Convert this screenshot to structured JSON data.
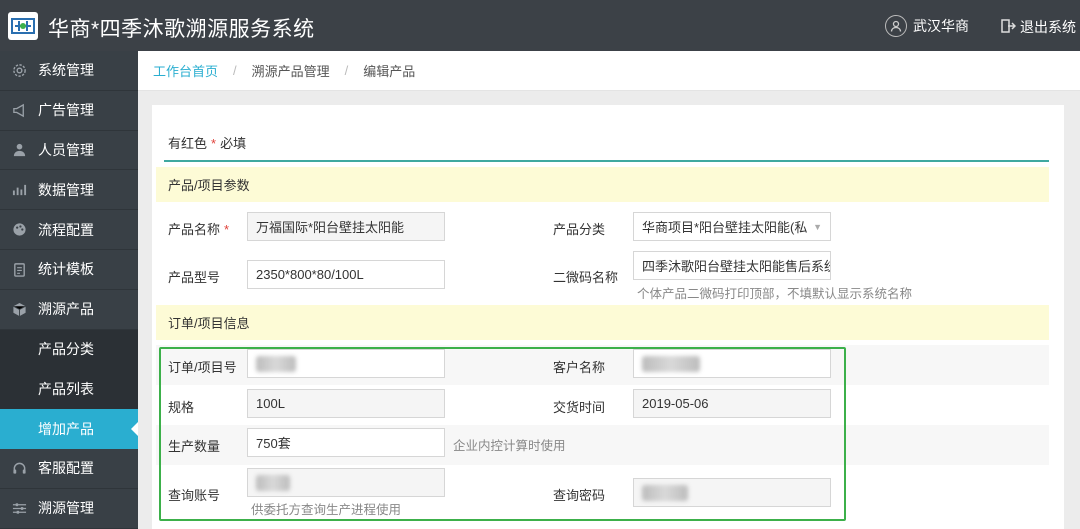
{
  "header": {
    "title": "华商*四季沐歌溯源服务系统",
    "user": "武汉华商",
    "logout": "退出系统"
  },
  "sidebar": {
    "items": [
      {
        "label": "系统管理",
        "icon": "gear-icon"
      },
      {
        "label": "广告管理",
        "icon": "megaphone-icon"
      },
      {
        "label": "人员管理",
        "icon": "person-icon"
      },
      {
        "label": "数据管理",
        "icon": "chart-icon"
      },
      {
        "label": "流程配置",
        "icon": "palette-icon"
      },
      {
        "label": "统计模板",
        "icon": "clipboard-icon"
      },
      {
        "label": "溯源产品",
        "icon": "box-icon"
      }
    ],
    "sub_items": [
      {
        "label": "产品分类"
      },
      {
        "label": "产品列表"
      },
      {
        "label": "增加产品",
        "active": true
      }
    ],
    "items_after": [
      {
        "label": "客服配置",
        "icon": "headset-icon"
      },
      {
        "label": "溯源管理",
        "icon": "sliders-icon"
      }
    ]
  },
  "breadcrumb": {
    "home": "工作台首页",
    "level1": "溯源产品管理",
    "current": "编辑产品"
  },
  "form": {
    "note_prefix": "有红色",
    "note_star": "*",
    "note_suffix": "必填",
    "section1": "产品/项目参数",
    "section2": "订单/项目信息",
    "product_name_label": "产品名称",
    "product_name_value": "万福国际*阳台壁挂太阳能",
    "product_category_label": "产品分类",
    "product_category_value": "华商项目*阳台壁挂太阳能(私",
    "product_model_label": "产品型号",
    "product_model_value": "2350*800*80/100L",
    "qrcode_name_label": "二微码名称",
    "qrcode_name_value": "四季沐歌阳台壁挂太阳能售后系统",
    "qrcode_hint": "个体产品二微码打印顶部，不填默认显示系统名称",
    "order_no_label": "订单/项目号",
    "customer_label": "客户名称",
    "spec_label": "规格",
    "spec_value": "100L",
    "delivery_label": "交货时间",
    "delivery_value": "2019-05-06",
    "quantity_label": "生产数量",
    "quantity_value": "750套",
    "quantity_hint": "企业内控计算时使用",
    "query_account_label": "查询账号",
    "query_account_hint": "供委托方查询生产进程使用",
    "query_password_label": "查询密码"
  },
  "colors": {
    "accent": "#2aaed0",
    "header_bg": "#3c4147",
    "sidebar_bg": "#394046",
    "section_bg": "#fdfbd6",
    "highlight_border": "#3cb04a",
    "required": "#e0413a"
  }
}
